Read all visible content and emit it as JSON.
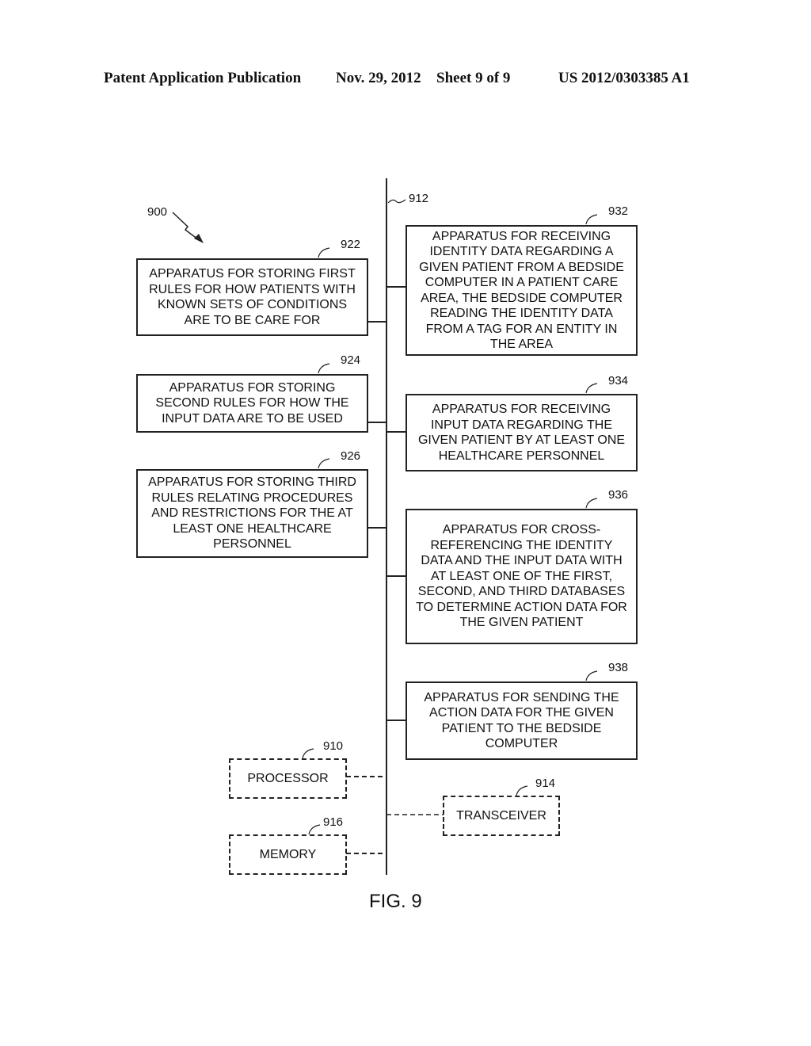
{
  "header": {
    "publication": "Patent Application Publication",
    "date": "Nov. 29, 2012",
    "sheet": "Sheet 9 of 9",
    "number": "US 2012/0303385 A1"
  },
  "diagram": {
    "system_ref": "900",
    "bus_ref": "912",
    "left_boxes": [
      {
        "ref": "922",
        "text": "APPARATUS FOR STORING FIRST RULES FOR HOW PATIENTS WITH KNOWN SETS OF CONDITIONS ARE TO BE CARE FOR"
      },
      {
        "ref": "924",
        "text": "APPARATUS FOR STORING SECOND RULES FOR HOW THE INPUT DATA ARE TO BE USED"
      },
      {
        "ref": "926",
        "text": "APPARATUS FOR STORING THIRD RULES RELATING PROCEDURES AND RESTRICTIONS FOR THE AT LEAST ONE HEALTHCARE PERSONNEL"
      }
    ],
    "right_boxes": [
      {
        "ref": "932",
        "text": "APPARATUS FOR RECEIVING IDENTITY DATA REGARDING A GIVEN PATIENT FROM A BEDSIDE COMPUTER IN A PATIENT CARE AREA, THE BEDSIDE COMPUTER READING THE IDENTITY DATA FROM A TAG FOR AN ENTITY IN THE AREA"
      },
      {
        "ref": "934",
        "text": "APPARATUS FOR RECEIVING INPUT DATA REGARDING THE GIVEN PATIENT BY AT LEAST ONE HEALTHCARE PERSONNEL"
      },
      {
        "ref": "936",
        "text": "APPARATUS FOR CROSS-REFERENCING THE IDENTITY DATA AND THE INPUT DATA WITH AT LEAST ONE OF THE FIRST, SECOND, AND THIRD DATABASES TO DETERMINE ACTION DATA FOR THE GIVEN PATIENT"
      },
      {
        "ref": "938",
        "text": "APPARATUS FOR SENDING THE ACTION DATA FOR THE GIVEN PATIENT TO THE BEDSIDE COMPUTER"
      }
    ],
    "processor": {
      "ref": "910",
      "text": "PROCESSOR"
    },
    "transceiver": {
      "ref": "914",
      "text": "TRANSCEIVER"
    },
    "memory": {
      "ref": "916",
      "text": "MEMORY"
    },
    "figure_label": "FIG. 9"
  }
}
